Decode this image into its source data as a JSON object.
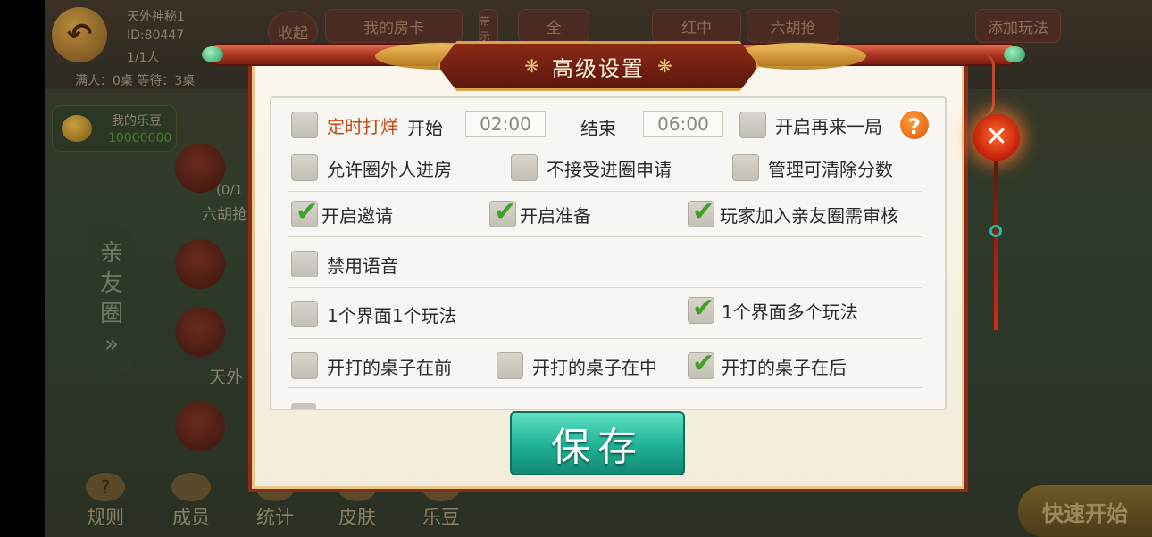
{
  "background": {
    "back_icon": "back-arrow-icon",
    "room_name": "天外神秘1",
    "room_id": "ID:80447",
    "players": "1/1人",
    "status_line": "满人：0桌   等待：3桌",
    "collapse_label": "收起",
    "card_label": "我的房卡",
    "rule_tag": "带 示",
    "top_tabs": [
      "全",
      "红中",
      "六胡抢",
      "添加玩法"
    ],
    "beans_label": "我的乐豆",
    "beans_value": "10000000",
    "side_tab": [
      "亲",
      "友",
      "圈",
      "»"
    ],
    "table_labels": [
      "(0/1",
      "六胡抢",
      "天外"
    ],
    "bottom_nav": [
      "规则",
      "成员",
      "统计",
      "皮肤",
      "乐豆"
    ],
    "quick_start": "快速开始"
  },
  "dialog": {
    "title": "高级设置",
    "title_ornament": "❋",
    "close_icon": "close-icon",
    "help_icon": "help-icon",
    "help_label": "?",
    "save_label": "保存",
    "rows": [
      {
        "items": [
          {
            "label": "定时打烊",
            "checked": false,
            "style": "orange"
          },
          {
            "label": "开启再来一局",
            "checked": false
          }
        ],
        "schedule": {
          "start_label": "开始",
          "start_value": "02:00",
          "end_label": "结束",
          "end_value": "06:00"
        }
      },
      {
        "items": [
          {
            "label": "允许圈外人进房",
            "checked": false
          },
          {
            "label": "不接受进圈申请",
            "checked": false
          },
          {
            "label": "管理可清除分数",
            "checked": false
          }
        ]
      },
      {
        "items": [
          {
            "label": "开启邀请",
            "checked": true
          },
          {
            "label": "开启准备",
            "checked": true
          },
          {
            "label": "玩家加入亲友圈需审核",
            "checked": true
          }
        ]
      },
      {
        "items": [
          {
            "label": "禁用语音",
            "checked": false
          }
        ]
      },
      {
        "items": [
          {
            "label": "1个界面1个玩法",
            "checked": false
          },
          {
            "label": "1个界面多个玩法",
            "checked": true
          }
        ]
      },
      {
        "items": [
          {
            "label": "开打的桌子在前",
            "checked": false
          },
          {
            "label": "开打的桌子在中",
            "checked": false
          },
          {
            "label": "开打的桌子在后",
            "checked": true
          }
        ]
      }
    ],
    "tick_glyph": "✔"
  }
}
